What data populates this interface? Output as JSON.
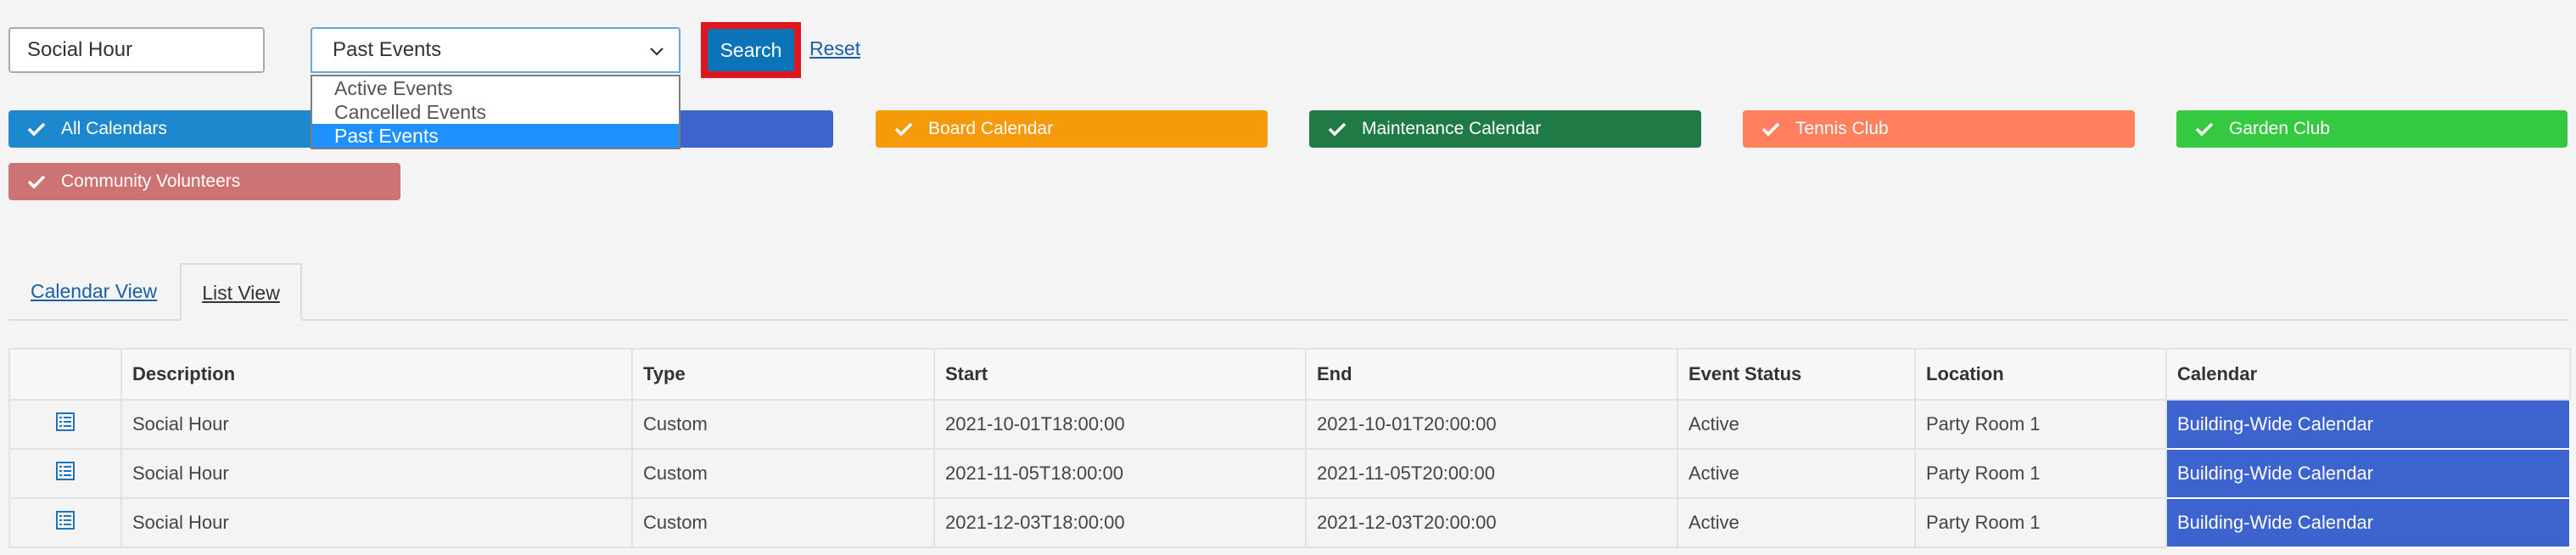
{
  "search": {
    "text_value": "Social Hour",
    "select_value": "Past Events",
    "options": [
      "Active Events",
      "Cancelled Events",
      "Past Events"
    ],
    "search_label": "Search",
    "reset_label": "Reset"
  },
  "calendars": [
    {
      "label": "All Calendars",
      "color": "#1e88cf"
    },
    {
      "label": "",
      "color": "#3d63cf"
    },
    {
      "label": "Board Calendar",
      "color": "#f59a0b"
    },
    {
      "label": "Maintenance Calendar",
      "color": "#1f7a45"
    },
    {
      "label": "Tennis Club",
      "color": "#ff7f5f"
    },
    {
      "label": "Garden Club",
      "color": "#35c941"
    },
    {
      "label": "Community Volunteers",
      "color": "#cd7373"
    }
  ],
  "tabs": {
    "calendar_view": "Calendar View",
    "list_view": "List View"
  },
  "table": {
    "columns": [
      "",
      "Description",
      "Type",
      "Start",
      "End",
      "Event Status",
      "Location",
      "Calendar"
    ],
    "rows": [
      {
        "description": "Social Hour",
        "type": "Custom",
        "start": "2021-10-01T18:00:00",
        "end": "2021-10-01T20:00:00",
        "status": "Active",
        "location": "Party Room 1",
        "calendar": "Building-Wide Calendar"
      },
      {
        "description": "Social Hour",
        "type": "Custom",
        "start": "2021-11-05T18:00:00",
        "end": "2021-11-05T20:00:00",
        "status": "Active",
        "location": "Party Room 1",
        "calendar": "Building-Wide Calendar"
      },
      {
        "description": "Social Hour",
        "type": "Custom",
        "start": "2021-12-03T18:00:00",
        "end": "2021-12-03T20:00:00",
        "status": "Active",
        "location": "Party Room 1",
        "calendar": "Building-Wide Calendar"
      }
    ]
  },
  "icons": {
    "chip": "check-icon",
    "row": "list-detail-icon",
    "select": "chevron-down-icon"
  }
}
